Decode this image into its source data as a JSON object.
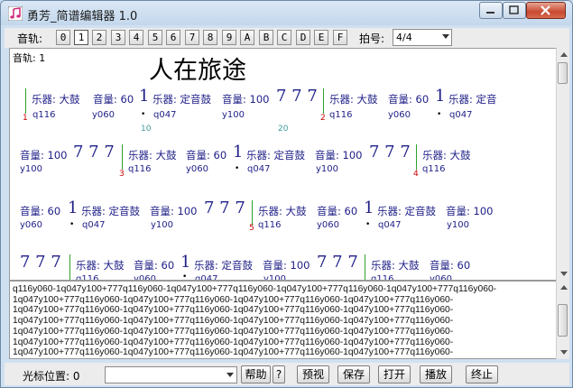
{
  "window": {
    "title": "勇芳_简谱编辑器 1.0"
  },
  "toolbar": {
    "track_label": "音轨:",
    "tracks": [
      "0",
      "1",
      "2",
      "3",
      "4",
      "5",
      "6",
      "7",
      "8",
      "9",
      "A",
      "B",
      "C",
      "D",
      "E",
      "F"
    ],
    "selected_track": "1",
    "meter_label": "拍号:",
    "meter_value": "4/4"
  },
  "score": {
    "track_label": "音轨: 1",
    "title": "人在旅途",
    "instrument_drum": "乐器: 大鼓",
    "instrument_fixed_drum": "乐器: 定音鼓",
    "instrument_fixed_drum_short": "乐器: 定音",
    "volume_60": "音量: 60",
    "volume_100": "音量: 100",
    "note_1": "1",
    "notes_777": "7 7 7",
    "code_q116": "q116",
    "code_y060": "y060",
    "code_q047": "q047",
    "code_y100": "y100",
    "dot": "•",
    "measure_1": "1",
    "measure_2": "2",
    "measure_3": "3",
    "measure_4": "4",
    "measure_5": "5",
    "ruler_10": "10",
    "ruler_20": "20"
  },
  "code": {
    "lines": [
      "q116y060-1q047y100+777q116y060-1q047y100+777q116y060-1q047y100+777q116y060-1q047y100+777q116y060-",
      "1q047y100+777q116y060-1q047y100+777q116y060-1q047y100+777q116y060-1q047y100+777q116y060-",
      "1q047y100+777q116y060-1q047y100+777q116y060-1q047y100+777q116y060-1q047y100+777q116y060-",
      "1q047y100+777q116y060-1q047y100+777q116y060-1q047y100+777q116y060-1q047y100+777q116y060-",
      "1q047y100+777q116y060-1q047y100+777q116y060-1q047y100+777q116y060-1q047y100+777q116y060-",
      "1q047y100+777q116y060-1q047y100+777q116y060-1q047y100+777q116y060-1q047y100+777q116y060-",
      "1q047y100+777q116y060-1q047y100+777q116y060-1q047y100+777q116y060-1q047y100+777q116y060-"
    ]
  },
  "status": {
    "cursor_label": "光标位置: 0",
    "help": "帮助",
    "question": "?",
    "preview": "预视",
    "save": "保存",
    "open": "打开",
    "play": "播放",
    "stop": "终止"
  }
}
